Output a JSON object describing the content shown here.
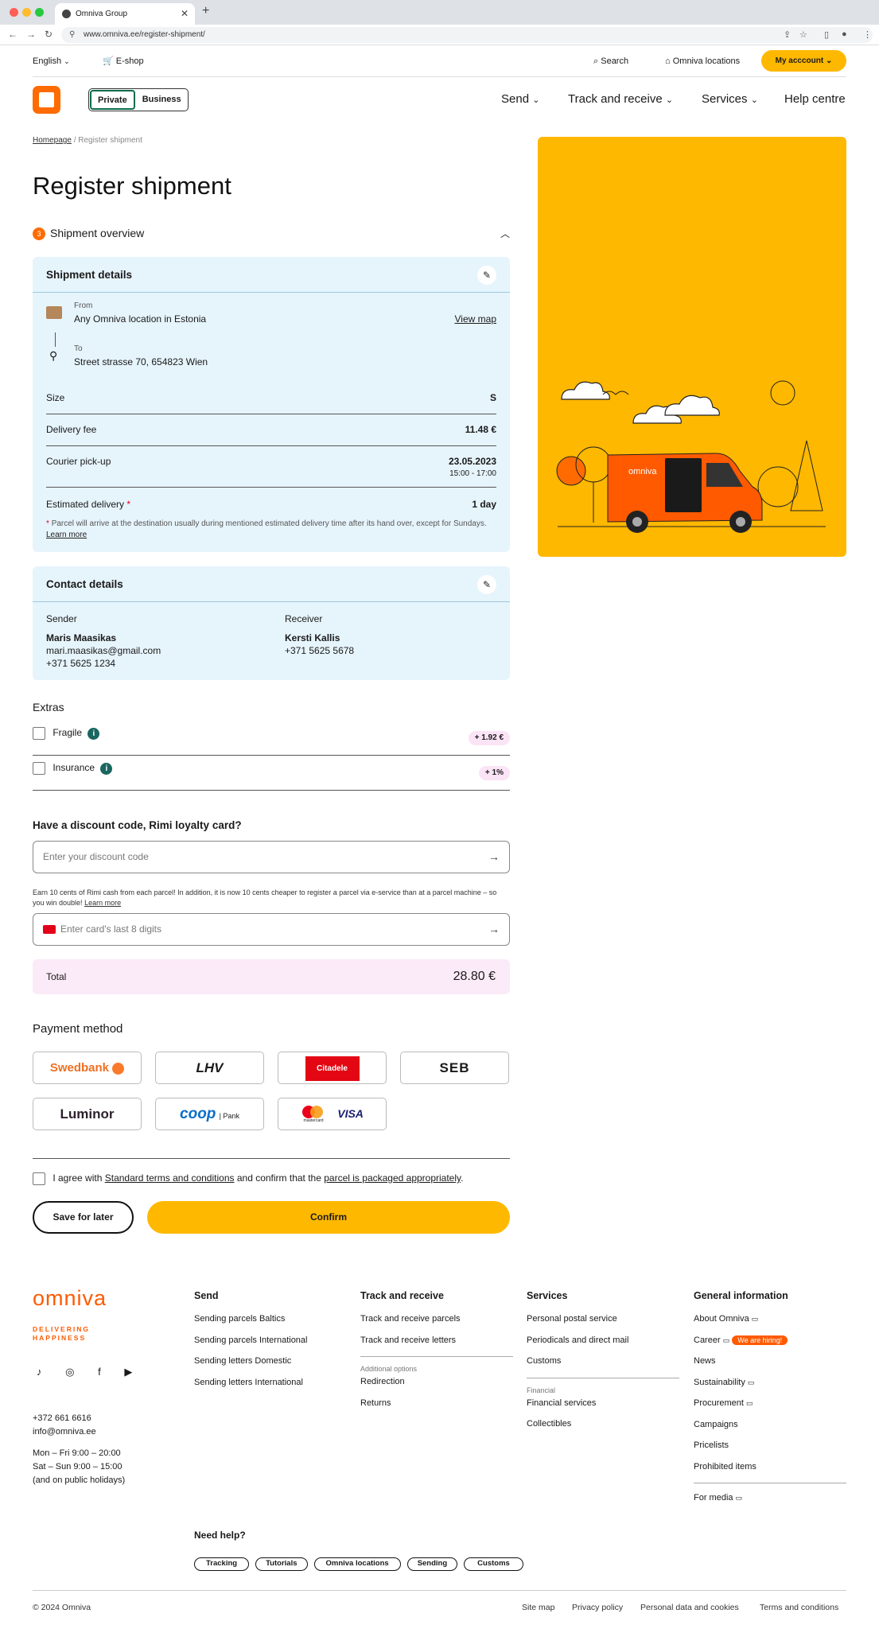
{
  "browser": {
    "tab_title": "Omniva Group",
    "url": "www.omniva.ee/register-shipment/"
  },
  "topbar": {
    "language": "English",
    "eshop": "E-shop",
    "search": "Search",
    "locations": "Omniva locations",
    "account": "My acccount"
  },
  "nav": {
    "private": "Private",
    "business": "Business",
    "menu": [
      "Send",
      "Track and receive",
      "Services",
      "Help centre"
    ]
  },
  "breadcrumb": {
    "home": "Homepage",
    "current": "Register shipment"
  },
  "page_title": "Register shipment",
  "overview": {
    "step": "3",
    "title": "Shipment overview"
  },
  "shipment": {
    "title": "Shipment details",
    "from_label": "From",
    "from_value": "Any Omniva location in Estonia",
    "view_map": "View map",
    "to_label": "To",
    "to_value": "Street strasse 70, 654823 Wien",
    "size_label": "Size",
    "size_value": "S",
    "fee_label": "Delivery fee",
    "fee_value": "11.48 €",
    "pickup_label": "Courier pick-up",
    "pickup_date": "23.05.2023",
    "pickup_time": "15:00 - 17:00",
    "est_label": "Estimated delivery",
    "est_value": "1 day",
    "note": "Parcel will arrive at the destination usually during mentioned estimated delivery time after its hand over, except for Sundays.",
    "learn_more": "Learn more"
  },
  "contact": {
    "title": "Contact details",
    "sender_label": "Sender",
    "sender_name": "Maris Maasikas",
    "sender_email": "mari.maasikas@gmail.com",
    "sender_phone": "+371 5625 1234",
    "receiver_label": "Receiver",
    "receiver_name": "Kersti Kallis",
    "receiver_phone": "+371 5625 5678"
  },
  "extras": {
    "title": "Extras",
    "fragile": "Fragile",
    "fragile_price": "+ 1.92 €",
    "insurance": "Insurance",
    "insurance_price": "+ 1%"
  },
  "discount": {
    "title": "Have a discount code, Rimi loyalty card?",
    "placeholder": "Enter your discount code",
    "rimi_text": "Earn 10 cents of Rimi cash from each parcel! In addition, it is now 10 cents cheaper to register a parcel via e-service than at a parcel machine – so you win double!",
    "learn_more": "Learn more",
    "card_placeholder": "Enter card's last 8 digits"
  },
  "total": {
    "label": "Total",
    "value": "28.80 €"
  },
  "payment": {
    "title": "Payment method",
    "methods": [
      "Swedbank",
      "LHV",
      "Citadele",
      "SEB",
      "Luminor",
      "coop",
      "VISA"
    ],
    "coop_suffix": "| Pank",
    "mastercard": "mastercard"
  },
  "agree": {
    "prefix": "I agree with",
    "terms": "Standard terms and conditions",
    "middle": "and confirm that the",
    "packaged": "parcel is packaged appropriately",
    "suffix": "."
  },
  "actions": {
    "save": "Save for later",
    "confirm": "Confirm"
  },
  "illustration": {
    "van_brand": "omniva"
  },
  "footer": {
    "brand": "omniva",
    "tagline1": "DELIVERING",
    "tagline2": "HAPPINESS",
    "phone": "+372 661 6616",
    "email": "info@omniva.ee",
    "hours1": "Mon – Fri 9:00 – 20:00",
    "hours2": "Sat – Sun 9:00 – 15:00",
    "hours3": "(and on public holidays)",
    "send": {
      "title": "Send",
      "items": [
        "Sending parcels Baltics",
        "Sending parcels International",
        "Sending letters Domestic",
        "Sending letters International"
      ]
    },
    "track": {
      "title": "Track and receive",
      "items": [
        "Track and receive parcels",
        "Track and receive letters"
      ],
      "sub": "Additional options",
      "sub_items": [
        "Redirection",
        "Returns"
      ]
    },
    "services": {
      "title": "Services",
      "items": [
        "Personal postal service",
        "Periodicals and direct mail",
        "Customs"
      ],
      "sub": "Financial",
      "sub_items": [
        "Financial services",
        "Collectibles"
      ]
    },
    "general": {
      "title": "General information",
      "items": [
        "About Omniva",
        "Career",
        "News",
        "Sustainability",
        "Procurement",
        "Campaigns",
        "Pricelists",
        "Prohibited items"
      ],
      "hiring": "We are hiring!",
      "media": "For media"
    },
    "help_title": "Need help?",
    "help_tags": [
      "Tracking",
      "Tutorials",
      "Omniva locations",
      "Sending",
      "Customs"
    ],
    "copyright": "© 2024 Omniva",
    "bottom_links": [
      "Site map",
      "Privacy policy",
      "Personal data and cookies",
      "Terms and conditions"
    ]
  },
  "colors": {
    "accent": "#ffb800",
    "brand": "#ff6b00",
    "card": "#e6f4fc",
    "total": "#fbeaf7"
  }
}
